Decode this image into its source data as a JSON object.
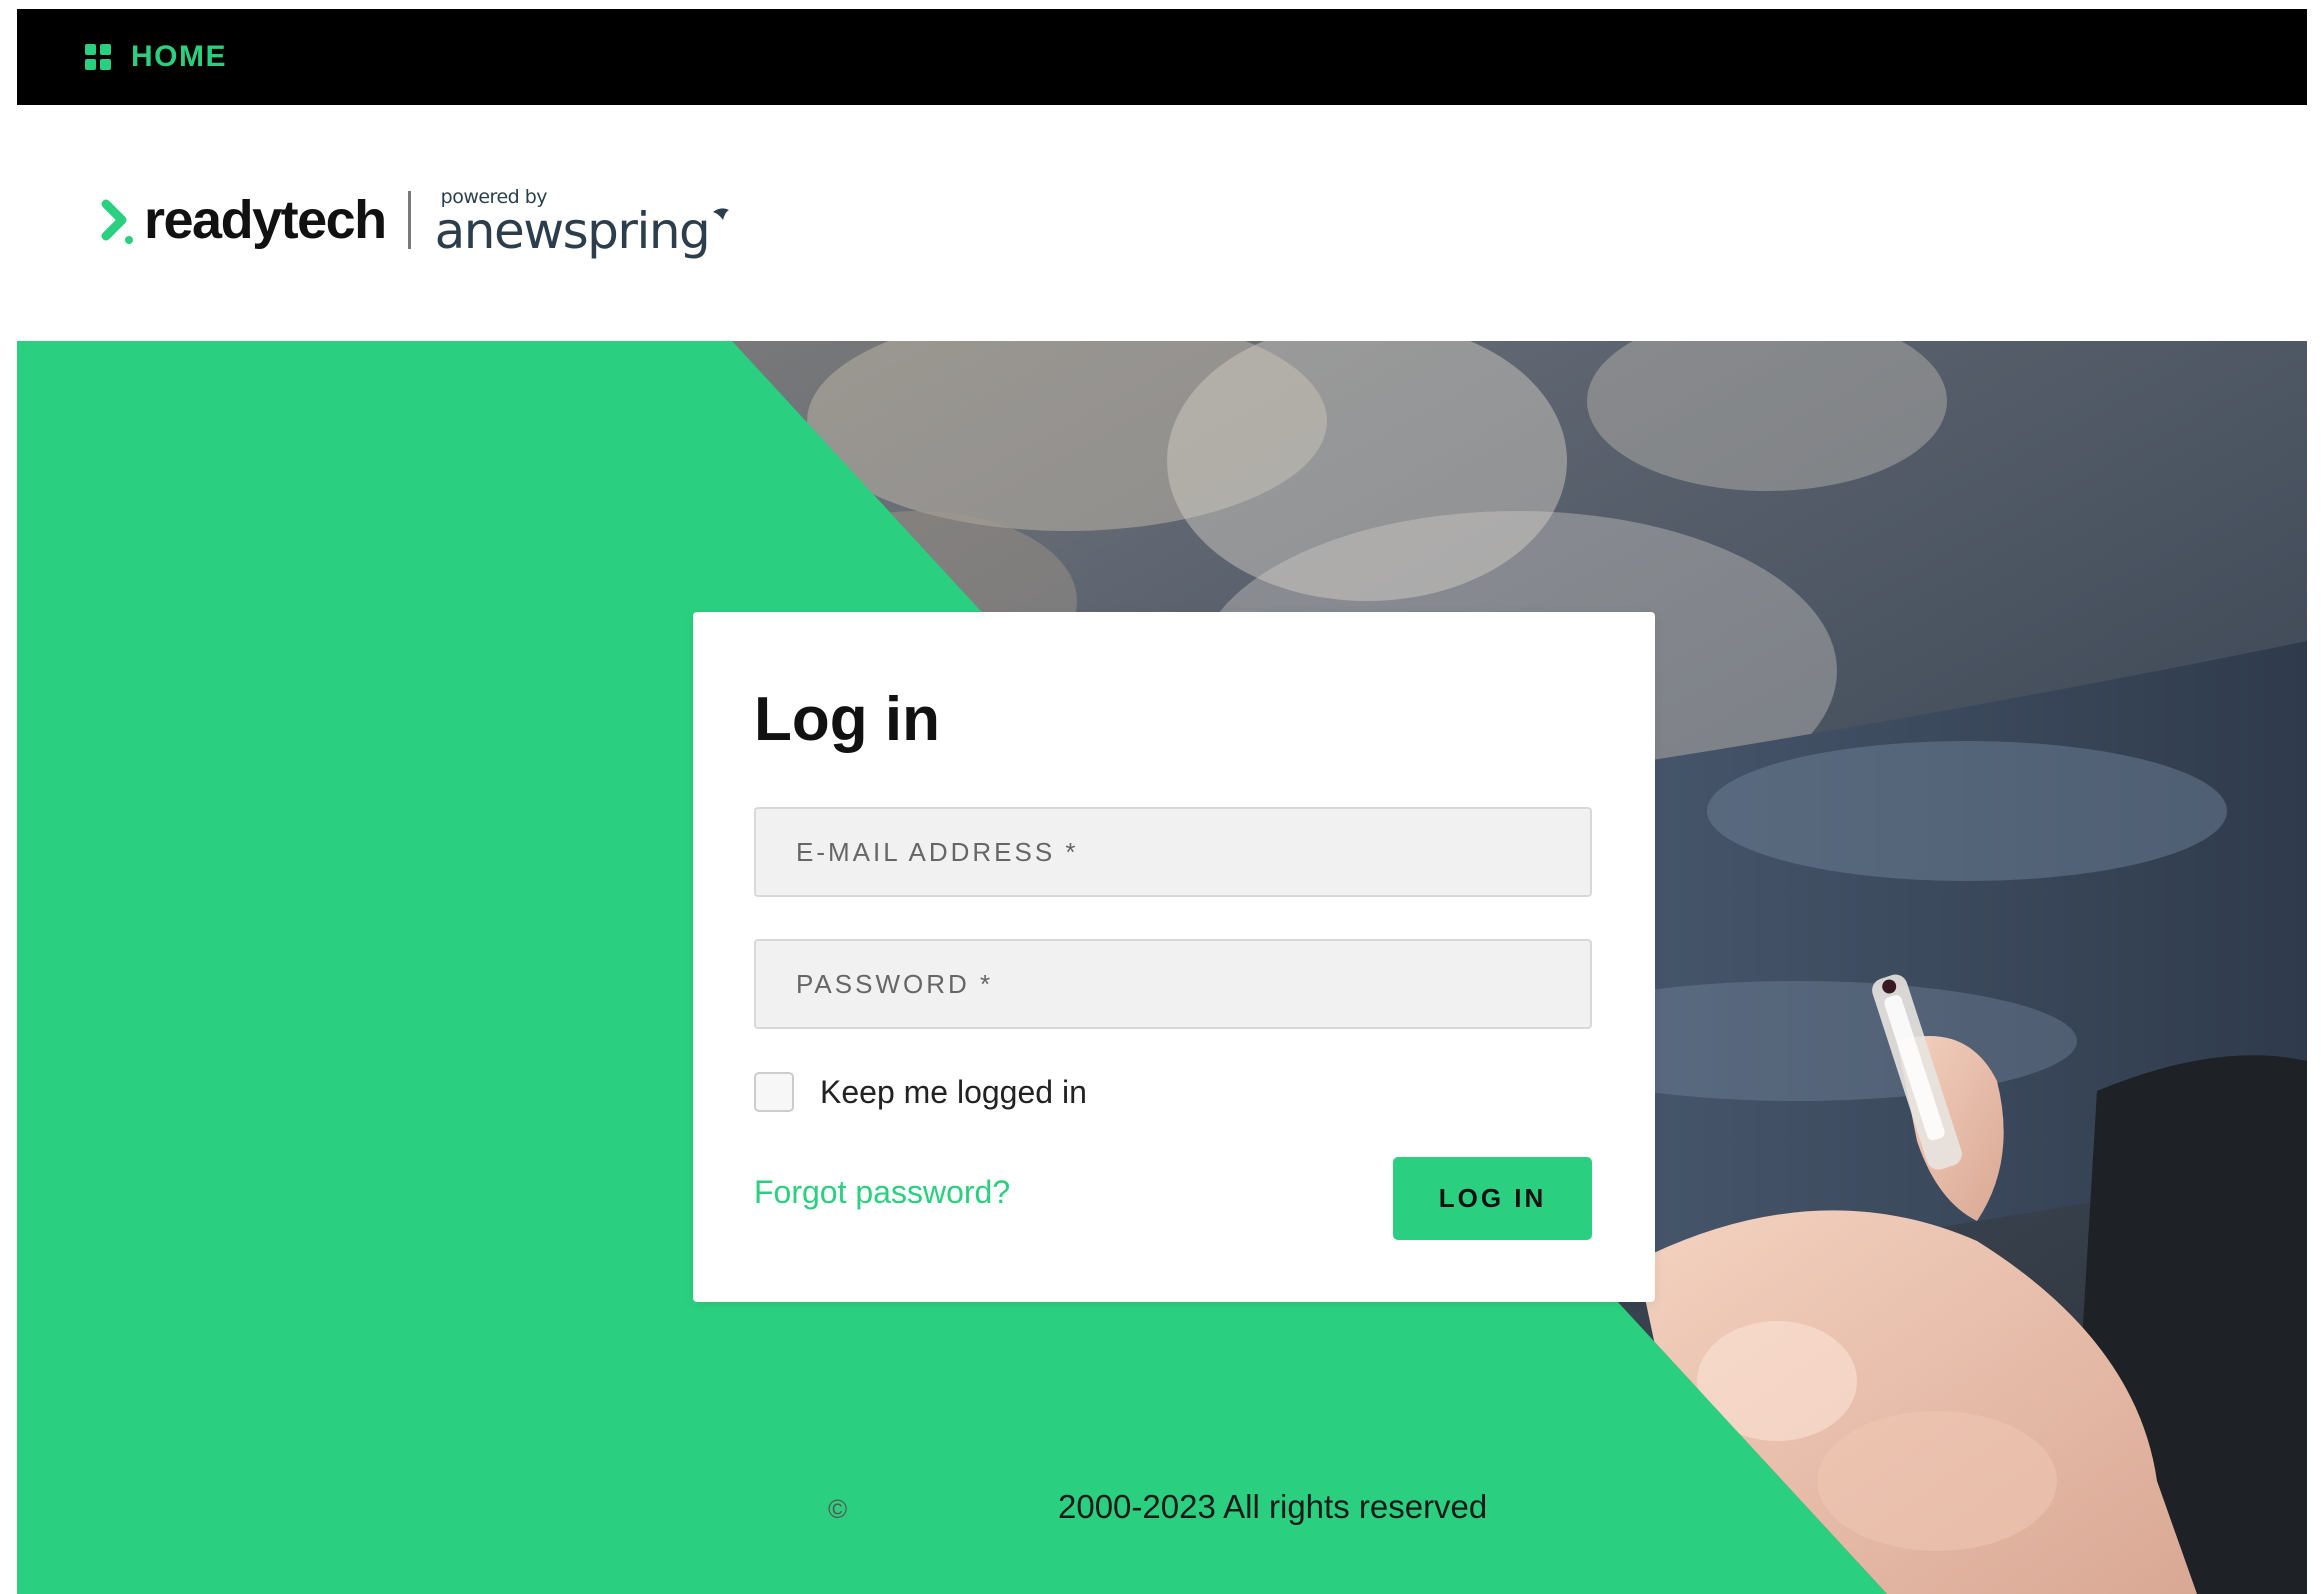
{
  "nav": {
    "home_label": "HOME",
    "home_icon": "grid-icon"
  },
  "branding": {
    "readytech_word": "readytech",
    "powered_by": "powered by",
    "newspring_word": "anewspring",
    "chevron_icon": "chevron-right-icon",
    "accent_color": "#2ad07f"
  },
  "login": {
    "title": "Log in",
    "email_placeholder": "E-MAIL ADDRESS *",
    "password_placeholder": "PASSWORD *",
    "keep_logged_in_label": "Keep me logged in",
    "keep_logged_in_checked": false,
    "forgot_password_label": "Forgot password?",
    "submit_label": "LOG IN"
  },
  "footer": {
    "copyright_symbol": "©",
    "text": "2000-2023 All rights reserved"
  }
}
